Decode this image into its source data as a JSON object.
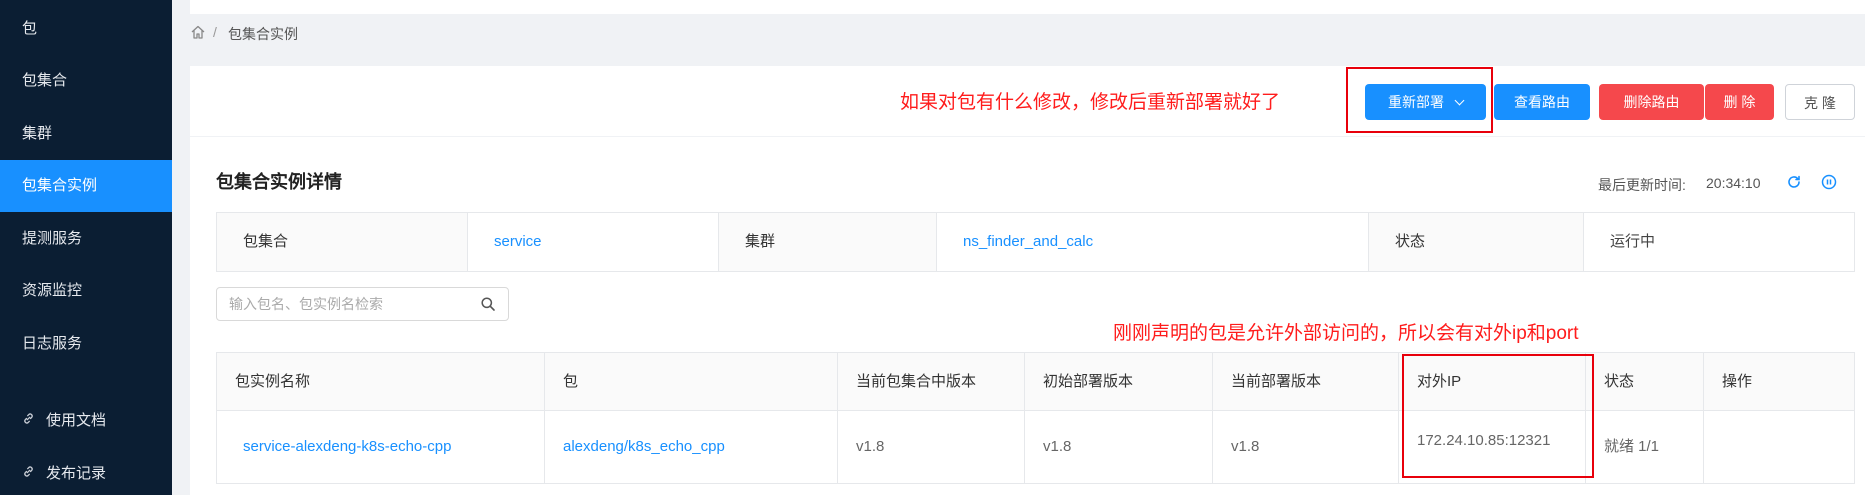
{
  "sidebar": {
    "items": [
      {
        "label": "包"
      },
      {
        "label": "包集合"
      },
      {
        "label": "集群"
      },
      {
        "label": "包集合实例",
        "active": true
      },
      {
        "label": "提测服务"
      },
      {
        "label": "资源监控"
      },
      {
        "label": "日志服务"
      },
      {
        "label": "使用文档",
        "icon": "link-icon"
      },
      {
        "label": "发布记录",
        "icon": "link-icon"
      }
    ]
  },
  "breadcrumb": {
    "current": "包集合实例",
    "separator": "/"
  },
  "annotations": {
    "redeploy_note": "如果对包有什么修改，修改后重新部署就好了",
    "ip_note": "刚刚声明的包是允许外部访问的，所以会有对外ip和port"
  },
  "toolbar": {
    "redeploy": "重新部署",
    "view_route": "查看路由",
    "delete_route": "删除路由",
    "delete": "删 除",
    "clone": "克 隆"
  },
  "detail": {
    "title": "包集合实例详情",
    "last_update_label": "最后更新时间:",
    "last_update_time": "20:34:10",
    "info": [
      {
        "label": "包集合",
        "value": "service"
      },
      {
        "label": "集群",
        "value": "ns_finder_and_calc"
      },
      {
        "label": "状态",
        "value": "运行中"
      }
    ]
  },
  "search": {
    "placeholder": "输入包名、包实例名检索",
    "value": ""
  },
  "table": {
    "columns": [
      "包实例名称",
      "包",
      "当前包集合中版本",
      "初始部署版本",
      "当前部署版本",
      "对外IP",
      "状态",
      "操作"
    ],
    "rows": [
      [
        "service-alexdeng-k8s-echo-cpp",
        "alexdeng/k8s_echo_cpp",
        "v1.8",
        "v1.8",
        "v1.8",
        "172.24.10.85:12321",
        "就绪 1/1",
        ""
      ]
    ]
  },
  "colors": {
    "sidebar_bg": "#0b1e33",
    "primary": "#1890ff",
    "danger": "#f5484c",
    "annotation": "#ff1c1c"
  }
}
